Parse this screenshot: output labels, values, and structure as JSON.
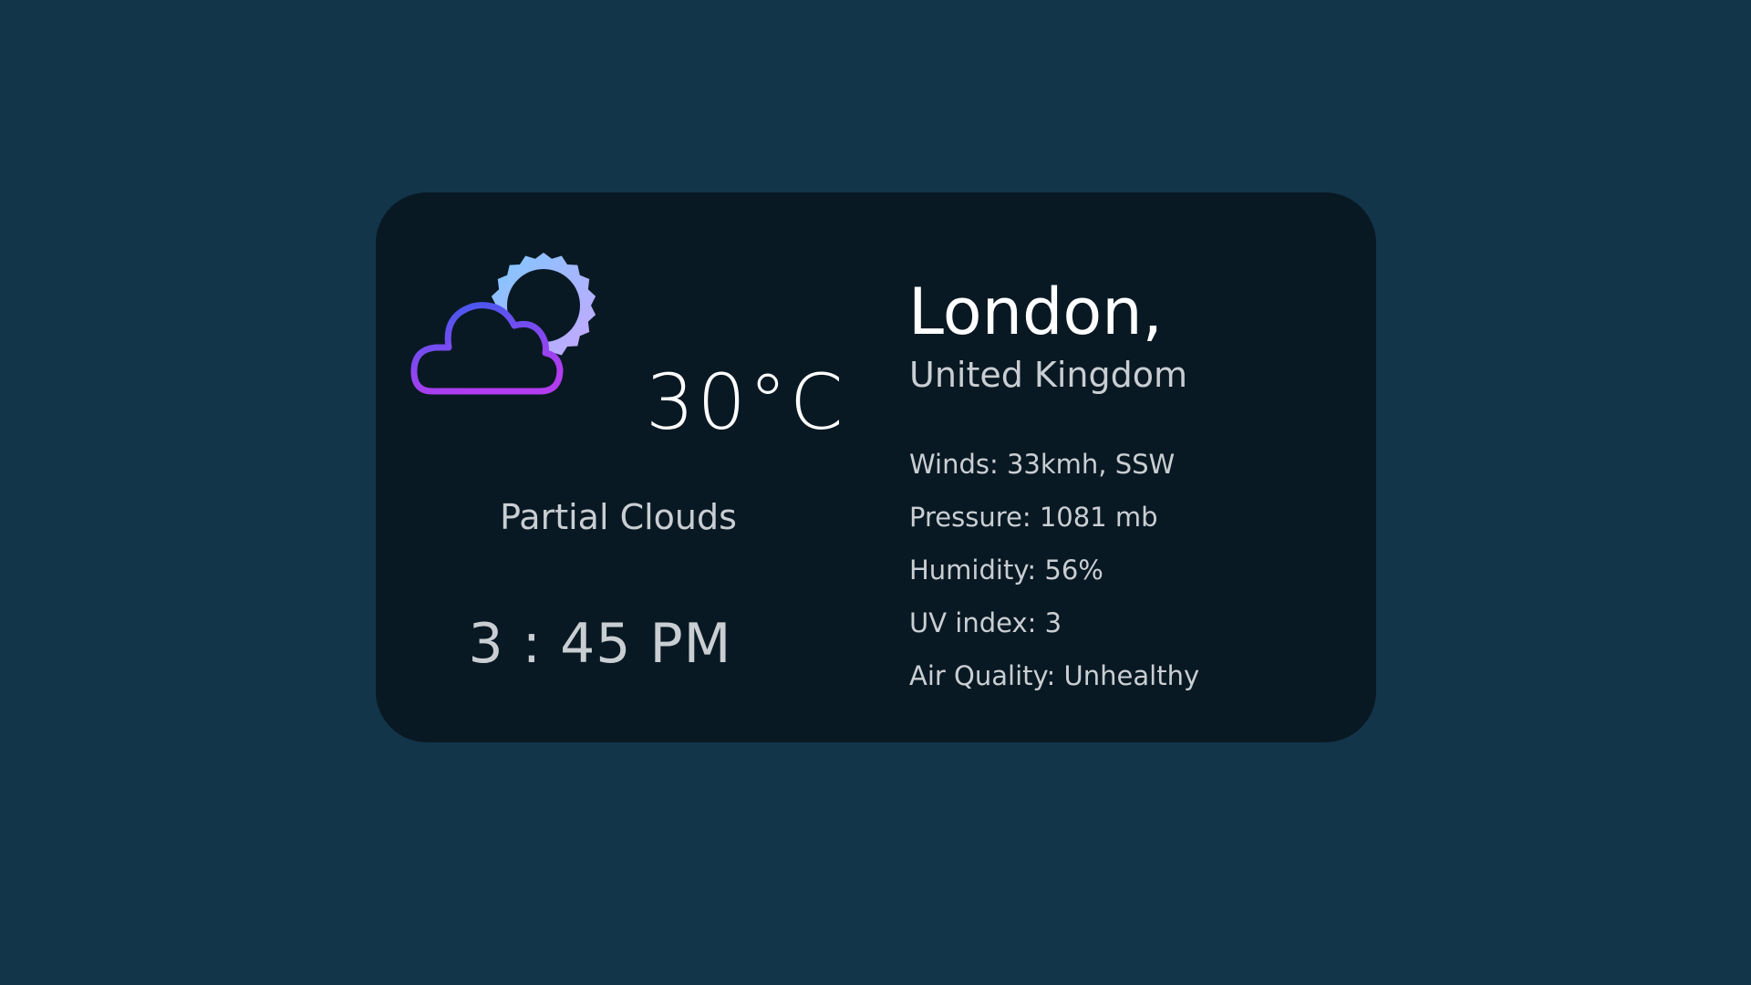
{
  "weather": {
    "icon": "partly-cloudy-icon",
    "temperature": "30°C",
    "condition": "Partial Clouds",
    "time": "3 : 45 PM"
  },
  "location": {
    "city": "London,",
    "country": "United Kingdom"
  },
  "details": [
    {
      "text": "Winds: 33kmh, SSW"
    },
    {
      "text": "Pressure: 1081 mb"
    },
    {
      "text": "Humidity: 56%"
    },
    {
      "text": "UV index: 3"
    },
    {
      "text": "Air Quality: Unhealthy"
    }
  ],
  "colors": {
    "background": "#12354a",
    "card": "#091923",
    "primary_text": "#ffffff",
    "secondary_text": "#c9ced3",
    "icon_gradient_start": "#3d5bf0",
    "icon_gradient_end": "#b23cf0",
    "sun_gradient_start": "#7ec8ff",
    "sun_gradient_end": "#c9a6ff"
  }
}
